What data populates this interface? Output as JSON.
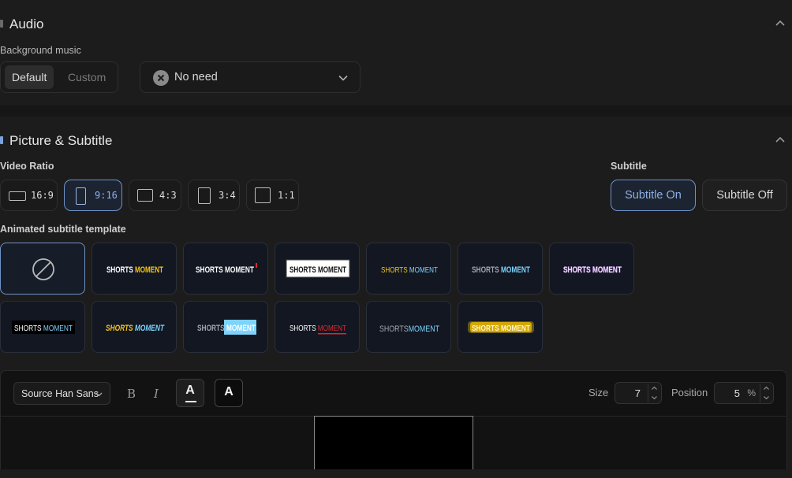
{
  "audio": {
    "title": "Audio",
    "bg_music_label": "Background music",
    "modes": [
      "Default",
      "Custom"
    ],
    "active_mode": "Default",
    "music_value": "No need"
  },
  "picture": {
    "title": "Picture & Subtitle",
    "ratio_label": "Video Ratio",
    "ratios": [
      "16:9",
      "9:16",
      "4:3",
      "3:4",
      "1:1"
    ],
    "active_ratio": "9:16",
    "subtitle_label": "Subtitle",
    "subtitle_on": "Subtitle On",
    "subtitle_off": "Subtitle Off",
    "template_label": "Animated subtitle template",
    "template_word_1": "SHORTS",
    "template_word_2": "MOMENT",
    "template_count": 13
  },
  "editor": {
    "font": "Source Han Sans",
    "bold_label": "B",
    "italic_label": "I",
    "text_color_label": "A",
    "bg_color_label": "A",
    "size_label": "Size",
    "size_value": "7",
    "position_label": "Position",
    "position_value": "5",
    "position_unit": "%"
  },
  "colors": {
    "accent": "#6f92c8",
    "accent_text": "#8fb0e6",
    "yellow": "#f5c518",
    "cyan": "#7dd3fc",
    "red": "#e0262e"
  }
}
